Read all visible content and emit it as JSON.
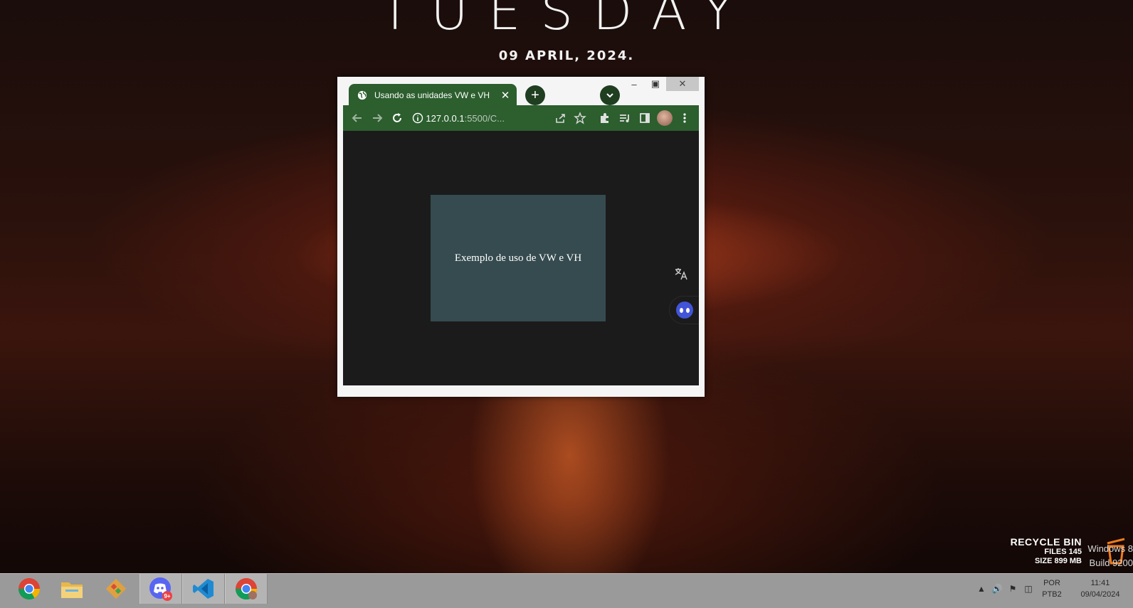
{
  "wallpaper": {
    "day": "TUESDAY",
    "date": "09 APRIL, 2024."
  },
  "browser": {
    "tab_title": "Usando as unidades VW e VH",
    "url_host": "127.0.0.1",
    "url_rest": ":5500/C...",
    "content_text": "Exemplo de uso de VW e VH",
    "accent_color": "#2c5e2e"
  },
  "recycle_bin": {
    "name": "RECYCLE BIN",
    "files": "FILES 145",
    "size": "SIZE 899 MB"
  },
  "watermark": {
    "line1": "Windows 8",
    "line2": "Build 9200"
  },
  "taskbar": {
    "apps": [
      "chrome-icon",
      "file-explorer-icon",
      "git-icon",
      "discord-icon",
      "vscode-icon",
      "chrome-profile-icon"
    ],
    "discord_badge": "9+",
    "language_top": "POR",
    "language_bottom": "PTB2",
    "time": "11:41",
    "date": "09/04/2024"
  }
}
